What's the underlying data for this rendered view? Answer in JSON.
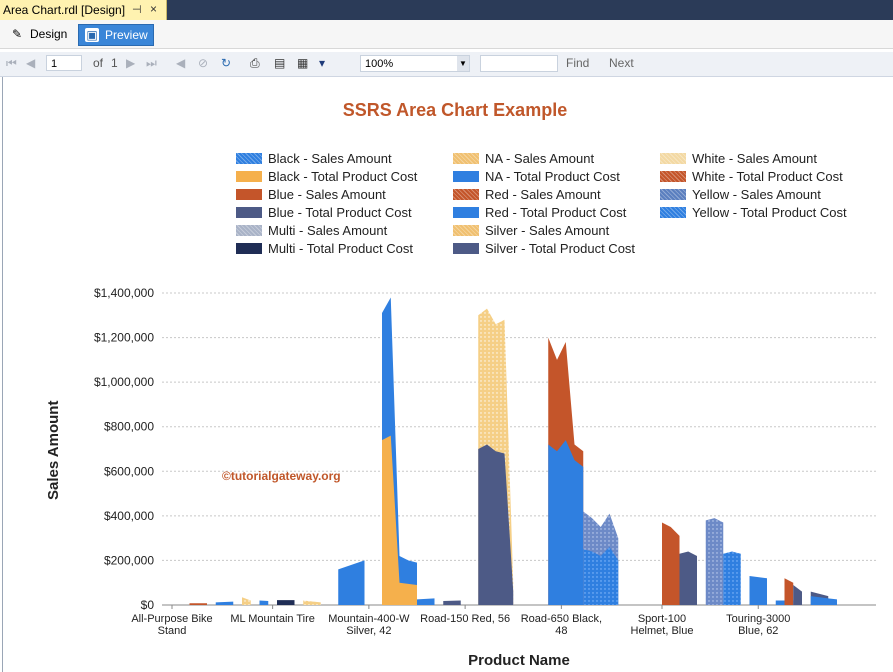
{
  "tab": {
    "title": "Area Chart.rdl [Design]",
    "pin": "⊣",
    "close": "×"
  },
  "views": {
    "design": "Design",
    "preview": "Preview"
  },
  "toolbar": {
    "page": "1",
    "of_label": "of",
    "total": "1",
    "zoom": "100%",
    "find": "Find",
    "next": "Next"
  },
  "chart_data": {
    "type": "area",
    "title": "SSRS Area Chart Example",
    "xlabel": "Product Name",
    "ylabel": "Sales Amount",
    "ylim": [
      0,
      1400000
    ],
    "y_ticks": [
      "$0",
      "$200,000",
      "$400,000",
      "$600,000",
      "$800,000",
      "$1,000,000",
      "$1,200,000",
      "$1,400,000"
    ],
    "x_ticks": [
      "All-Purpose Bike Stand",
      "ML Mountain Tire",
      "Mountain-400-W Silver, 42",
      "Road-150 Red, 56",
      "Road-650 Black, 48",
      "Sport-100 Helmet, Blue",
      "Touring-3000 Blue, 62"
    ],
    "grid": true,
    "legend_position": "top",
    "legend": [
      {
        "name": "Black - Sales Amount",
        "color": "#2f7fe0",
        "pattern": "dots"
      },
      {
        "name": "Black - Total Product Cost",
        "color": "#f5b04c",
        "pattern": "solid"
      },
      {
        "name": "Blue - Sales Amount",
        "color": "#c4552a",
        "pattern": "solid"
      },
      {
        "name": "Blue - Total Product Cost",
        "color": "#4d5a86",
        "pattern": "solid"
      },
      {
        "name": "Multi - Sales Amount",
        "color": "#a9b3c7",
        "pattern": "dots"
      },
      {
        "name": "Multi - Total Product Cost",
        "color": "#1f2d55",
        "pattern": "solid"
      },
      {
        "name": "NA - Sales Amount",
        "color": "#f0c070",
        "pattern": "dots"
      },
      {
        "name": "NA - Total Product Cost",
        "color": "#2f7fe0",
        "pattern": "solid"
      },
      {
        "name": "Red - Sales Amount",
        "color": "#c4552a",
        "pattern": "dots"
      },
      {
        "name": "Red - Total Product Cost",
        "color": "#2f7fe0",
        "pattern": "solid"
      },
      {
        "name": "Silver - Sales Amount",
        "color": "#f0c070",
        "pattern": "dots"
      },
      {
        "name": "Silver - Total Product Cost",
        "color": "#4d5a86",
        "pattern": "solid"
      },
      {
        "name": "White - Sales Amount",
        "color": "#f3d9a3",
        "pattern": "dots"
      },
      {
        "name": "White - Total Product Cost",
        "color": "#c4552a",
        "pattern": "dots"
      },
      {
        "name": "Yellow - Sales Amount",
        "color": "#5b7fbf",
        "pattern": "dots"
      },
      {
        "name": "Yellow - Total Product Cost",
        "color": "#2f7fe0",
        "pattern": "dots"
      }
    ],
    "series": [
      {
        "name": "Black - Sales Amount",
        "x": [
          34,
          35,
          36,
          37,
          38,
          39,
          40,
          41,
          42,
          43,
          44,
          45
        ],
        "values": [
          1310000,
          1380000,
          220000,
          200000,
          190000,
          180000,
          170000,
          160000,
          150000,
          140000,
          130000,
          120000
        ]
      },
      {
        "name": "Black - Total Product Cost",
        "x": [
          34,
          35,
          36,
          37,
          38,
          39,
          40,
          41,
          42,
          43,
          44,
          45
        ],
        "values": [
          740000,
          760000,
          100000,
          95000,
          90000,
          85000,
          80000,
          75000,
          70000,
          65000,
          60000,
          55000
        ]
      },
      {
        "name": "Red - Sales Amount",
        "x": [
          50,
          51,
          52,
          53,
          54,
          55,
          56
        ],
        "values": [
          1200000,
          1100000,
          1180000,
          720000,
          690000,
          650000,
          600000
        ]
      },
      {
        "name": "Red - Total Product Cost",
        "x": [
          50,
          51,
          52,
          53,
          54,
          55,
          56
        ],
        "values": [
          720000,
          690000,
          740000,
          650000,
          620000,
          600000,
          580000
        ]
      },
      {
        "name": "Silver - Sales Amount",
        "x": [
          37,
          38,
          39,
          40,
          41,
          42
        ],
        "values": [
          1300000,
          1330000,
          1260000,
          1280000,
          100000,
          95000
        ]
      },
      {
        "name": "Silver - Total Product Cost",
        "x": [
          37,
          38,
          39,
          40,
          41,
          42
        ],
        "values": [
          700000,
          720000,
          690000,
          680000,
          60000,
          55000
        ]
      },
      {
        "name": "Yellow - Sales Amount",
        "x": [
          56,
          57,
          58,
          59,
          60,
          61,
          62,
          63,
          64,
          65,
          66,
          67
        ],
        "values": [
          420000,
          390000,
          350000,
          410000,
          300000,
          360000,
          280000,
          330000,
          300000,
          340000,
          310000,
          300000
        ]
      },
      {
        "name": "Yellow - Total Product Cost",
        "x": [
          56,
          57,
          58,
          59,
          60,
          61,
          62,
          63,
          64,
          65,
          66,
          67
        ],
        "values": [
          250000,
          240000,
          220000,
          260000,
          200000,
          230000,
          190000,
          210000,
          200000,
          220000,
          210000,
          200000
        ]
      }
    ],
    "annotations": [
      "©tutorialgateway.org"
    ]
  }
}
